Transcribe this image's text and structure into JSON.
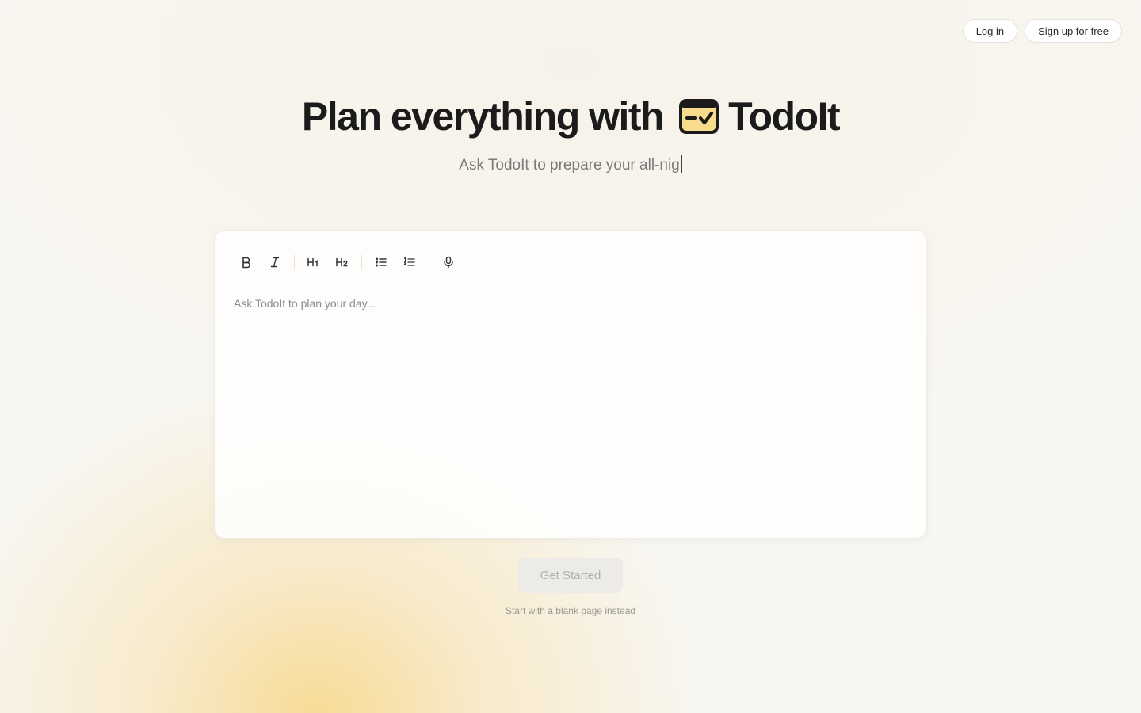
{
  "nav": {
    "login_label": "Log in",
    "signup_label": "Sign up for free"
  },
  "hero": {
    "title_prefix": "Plan everything with",
    "brand_name": "TodoIt",
    "logo_icon": "todo-card-check-icon",
    "subtitle_typed": "Ask TodoIt to prepare your all-nig"
  },
  "editor": {
    "toolbar": [
      {
        "name": "bold",
        "icon": "bold-icon"
      },
      {
        "name": "italic",
        "icon": "italic-icon"
      },
      {
        "name": "heading-1",
        "icon": "heading-1-icon"
      },
      {
        "name": "heading-2",
        "icon": "heading-2-icon"
      },
      {
        "name": "bullet-list",
        "icon": "bullet-list-icon"
      },
      {
        "name": "ordered-list",
        "icon": "ordered-list-icon"
      },
      {
        "name": "voice",
        "icon": "microphone-icon"
      }
    ],
    "placeholder": "Ask TodoIt to plan your day..."
  },
  "cta": {
    "get_started_label": "Get Started",
    "blank_page_label": "Start with a blank page instead"
  },
  "colors": {
    "background": "#f8f6f1",
    "accent_glow": "#f7d278",
    "logo_fill": "#f6dc8c",
    "text_primary": "#1b1b1b",
    "text_muted": "#7a7a7a"
  }
}
